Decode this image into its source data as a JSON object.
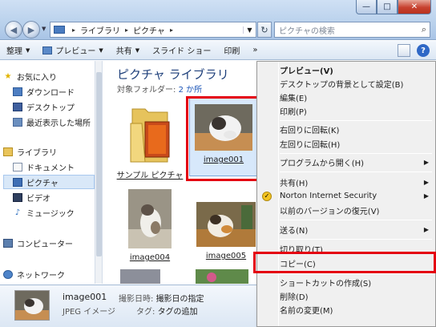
{
  "window": {
    "min": "—",
    "max": "□",
    "close": "✕"
  },
  "address": {
    "crumbs": [
      "ライブラリ",
      "ピクチャ"
    ]
  },
  "search": {
    "placeholder": "ピクチャの検索"
  },
  "toolbar": {
    "organize": "整理",
    "preview": "プレビュー",
    "share": "共有",
    "slideshow": "スライド ショー",
    "print": "印刷",
    "more": "»"
  },
  "sidebar": {
    "favorites": "お気に入り",
    "downloads": "ダウンロード",
    "desktop": "デスクトップ",
    "recent": "最近表示した場所",
    "libraries": "ライブラリ",
    "documents": "ドキュメント",
    "pictures": "ピクチャ",
    "videos": "ビデオ",
    "music": "ミュージック",
    "computer": "コンピューター",
    "network": "ネットワーク"
  },
  "main": {
    "title": "ピクチャ ライブラリ",
    "subtitle_prefix": "対象フォルダー: ",
    "subtitle_link": "2 か所",
    "items": [
      {
        "label": "サンプル ピクチャ"
      },
      {
        "label": "image001"
      },
      {
        "label": "image004"
      },
      {
        "label": "image005"
      }
    ]
  },
  "details": {
    "name": "image001",
    "type": "JPEG イメージ",
    "date_label": "撮影日時: ",
    "date_value": "撮影日の指定",
    "tag_label": "タグ: ",
    "tag_value": "タグの追加"
  },
  "context_menu": {
    "items": [
      {
        "label": "プレビュー(V)",
        "bold": true
      },
      {
        "label": "デスクトップの背景として設定(B)"
      },
      {
        "label": "編集(E)"
      },
      {
        "label": "印刷(P)"
      },
      {
        "label": "右回りに回転(K)"
      },
      {
        "label": "左回りに回転(H)"
      },
      {
        "label": "プログラムから開く(H)",
        "submenu": true
      },
      {
        "label": "共有(H)",
        "submenu": true
      },
      {
        "label": "Norton Internet Security",
        "submenu": true,
        "icon": "norton-icon"
      },
      {
        "label": "以前のバージョンの復元(V)"
      },
      {
        "label": "送る(N)",
        "submenu": true
      },
      {
        "label": "切り取り(T)"
      },
      {
        "label": "コピー(C)"
      },
      {
        "label": "ショートカットの作成(S)"
      },
      {
        "label": "削除(D)"
      },
      {
        "label": "名前の変更(M)"
      }
    ]
  },
  "colors": {
    "highlight_border": "#e4000f",
    "title_blue": "#1e3f7a"
  }
}
